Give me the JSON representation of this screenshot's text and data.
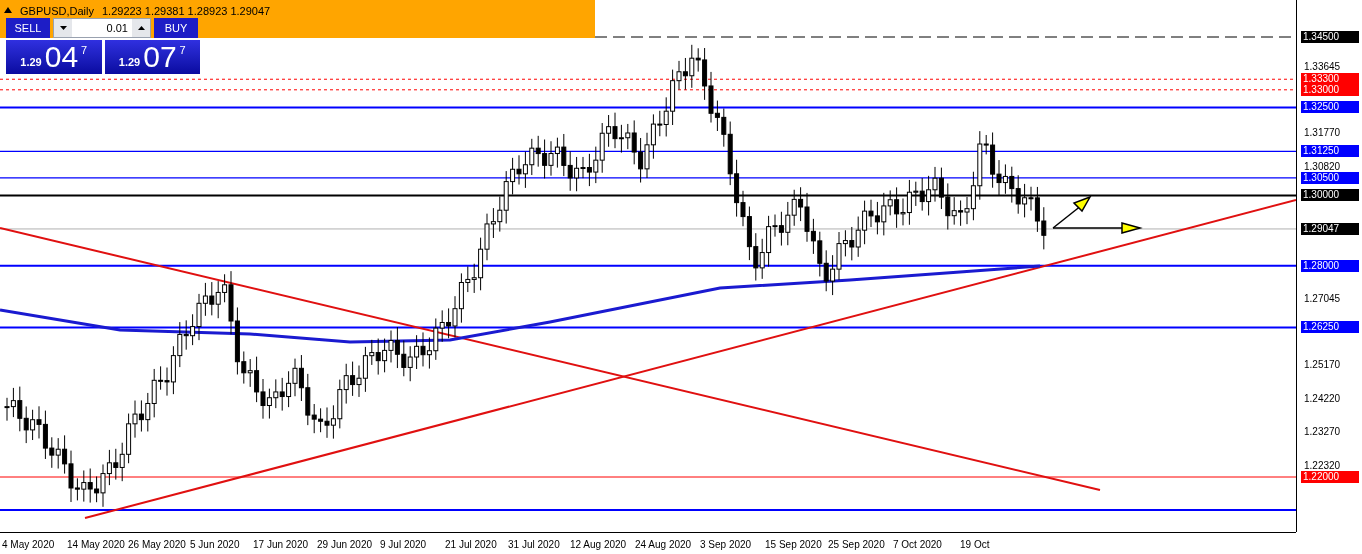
{
  "title_bar": {
    "symbol": "GBPUSD,Daily",
    "ohlc": "1.29223 1.29381 1.28923 1.29047"
  },
  "trade_panel": {
    "sell_label": "SELL",
    "buy_label": "BUY",
    "lot": "0.01",
    "sell_price": {
      "prefix": "1.29",
      "digits": "04",
      "pip": "7"
    },
    "buy_price": {
      "prefix": "1.29",
      "digits": "07",
      "pip": "7"
    }
  },
  "price_axis": {
    "ticks": [
      "1.33645",
      "1.31770",
      "1.30820",
      "1.27045",
      "1.25170",
      "1.24220",
      "1.23270",
      "1.22320"
    ],
    "levels": [
      {
        "label": "1.34500",
        "color": "#000000",
        "kind": "dashed"
      },
      {
        "label": "1.33300",
        "color": "#ff0000",
        "kind": "dotted"
      },
      {
        "label": "1.33000",
        "color": "#ff0000",
        "kind": "dotted"
      },
      {
        "label": "1.32500",
        "color": "#0000ff",
        "kind": "thick"
      },
      {
        "label": "1.31250",
        "color": "#0000ff",
        "kind": "solid"
      },
      {
        "label": "1.30500",
        "color": "#0000ff",
        "kind": "solid"
      },
      {
        "label": "1.30000",
        "color": "#000000",
        "kind": "thick"
      },
      {
        "label": "1.29047",
        "color": "#000000",
        "kind": "price"
      },
      {
        "label": "1.28000",
        "color": "#0000ff",
        "kind": "thick"
      },
      {
        "label": "1.26250",
        "color": "#0000ff",
        "kind": "thick"
      },
      {
        "label": "1.22000",
        "color": "#ff0000",
        "kind": "thin"
      }
    ]
  },
  "time_axis": {
    "labels": [
      "4 May 2020",
      "14 May 2020",
      "26 May 2020",
      "5 Jun 2020",
      "17 Jun 2020",
      "29 Jun 2020",
      "9 Jul 2020",
      "21 Jul 2020",
      "31 Jul 2020",
      "12 Aug 2020",
      "24 Aug 2020",
      "3 Sep 2020",
      "15 Sep 2020",
      "25 Sep 2020",
      "7 Oct 2020",
      "19 Oct"
    ]
  }
}
